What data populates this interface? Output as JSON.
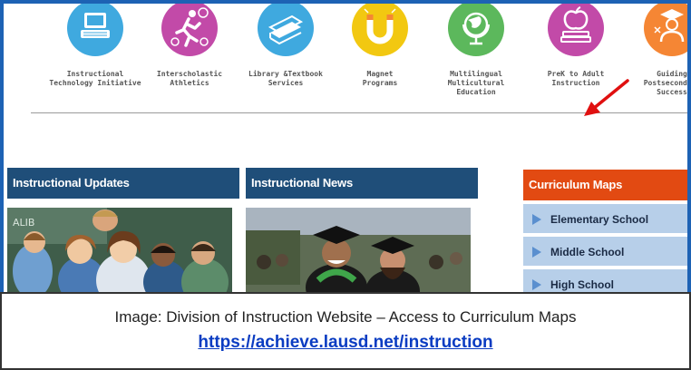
{
  "icons": [
    {
      "name": "instructional-technology",
      "label_lines": [
        "Instructional",
        "Technology Initiative"
      ],
      "color": "#3fa9df",
      "icon": "laptop-icon"
    },
    {
      "name": "interscholastic-athletics",
      "label_lines": [
        "Interscholastic",
        "Athletics"
      ],
      "color": "#c24aa8",
      "icon": "runner-icon"
    },
    {
      "name": "library-textbook",
      "label_lines": [
        "Library &Textbook",
        "Services"
      ],
      "color": "#3fa9df",
      "icon": "books-icon"
    },
    {
      "name": "magnet-programs",
      "label_lines": [
        "Magnet",
        "Programs"
      ],
      "color": "#f2c811",
      "icon": "magnet-icon"
    },
    {
      "name": "multilingual",
      "label_lines": [
        "Multilingual",
        "Multicultural Education"
      ],
      "color": "#5cb85c",
      "icon": "globe-icon"
    },
    {
      "name": "prek-adult",
      "label_lines": [
        "PreK to Adult",
        "Instruction"
      ],
      "color": "#c24aa8",
      "icon": "apple-books-icon"
    },
    {
      "name": "guiding-postsecondary",
      "label_lines": [
        "Guiding",
        "Postsecondary",
        "Success"
      ],
      "color": "#f58634",
      "icon": "graduate-icon"
    }
  ],
  "panels": {
    "updates": {
      "title": "Instructional Updates",
      "color": "#1f4e79"
    },
    "news": {
      "title": "Instructional News",
      "color": "#1f4e79"
    },
    "curriculum_maps": {
      "title": "Curriculum Maps",
      "color": "#e24a12",
      "items": [
        "Elementary School",
        "Middle School",
        "High School"
      ]
    }
  },
  "caption": {
    "text": "Image: Division of Instruction Website – Access to Curriculum Maps",
    "link": "https://achieve.lausd.net/instruction"
  }
}
